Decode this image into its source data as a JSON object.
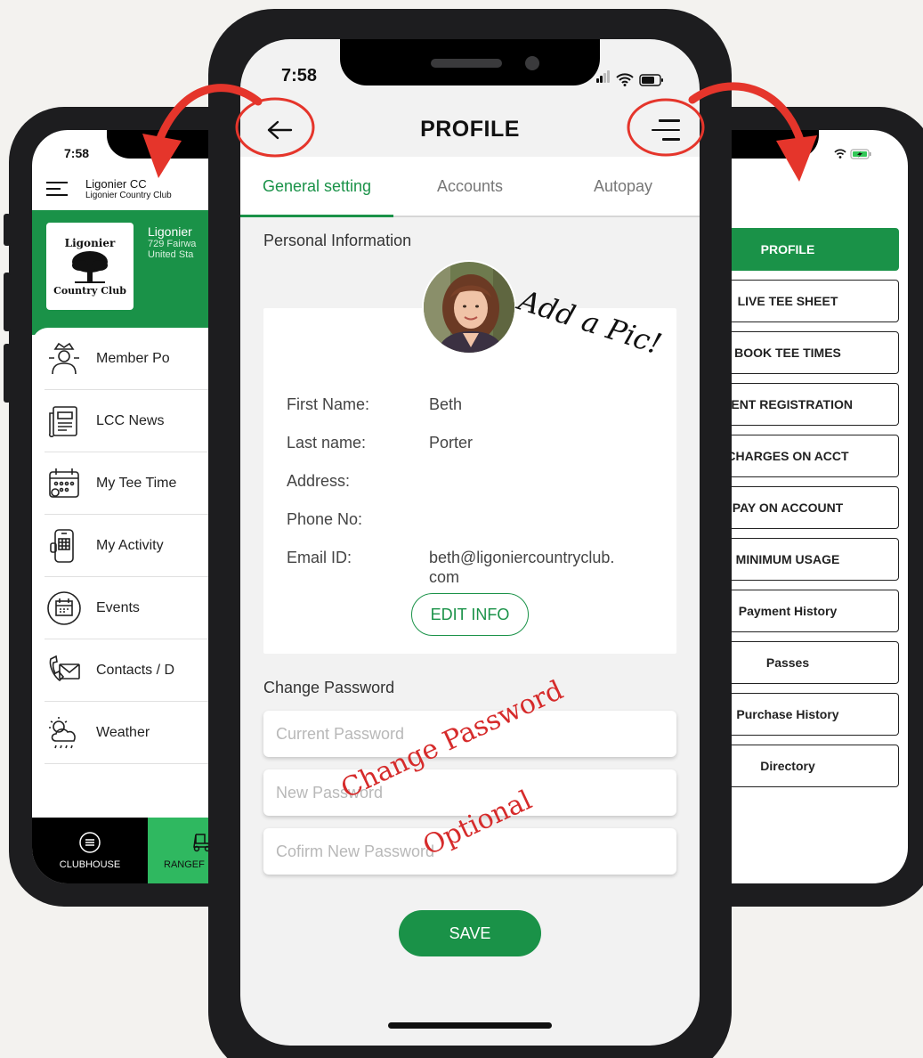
{
  "left_app": {
    "time": "7:58",
    "brand_title": "Ligonier CC",
    "brand_subtitle": "Ligonier Country Club",
    "logo_line1": "Ligonier",
    "logo_line2": "Country Club",
    "club_name": "Ligonier",
    "club_address1": "729 Fairwa",
    "club_address2": "United Sta",
    "menu": [
      {
        "label": "Member Po",
        "icon": "member-portal-icon"
      },
      {
        "label": "LCC News",
        "icon": "newspaper-icon"
      },
      {
        "label": "My Tee Time",
        "icon": "calendar-icon"
      },
      {
        "label": "My Activity",
        "icon": "phone-activity-icon"
      },
      {
        "label": "Events",
        "icon": "events-calendar-icon"
      },
      {
        "label": "Contacts / D",
        "icon": "contacts-icon"
      },
      {
        "label": "Weather",
        "icon": "weather-icon"
      }
    ],
    "tab_clubhouse": "CLUBHOUSE",
    "tab_ranger": "RANGEF"
  },
  "profile": {
    "time": "7:58",
    "title": "PROFILE",
    "tabs": [
      "General setting",
      "Accounts",
      "Autopay"
    ],
    "active_tab": 0,
    "personal_info_title": "Personal Information",
    "fields": [
      {
        "label": "First Name:",
        "value": "Beth"
      },
      {
        "label": "Last name:",
        "value": "Porter"
      },
      {
        "label": "Address:",
        "value": ""
      },
      {
        "label": "Phone No:",
        "value": ""
      },
      {
        "label": "Email ID:",
        "value": "beth@ligoniercountryclub.\ncom"
      }
    ],
    "edit_button": "EDIT INFO",
    "change_password_title": "Change Password",
    "current_password_placeholder": "Current Password",
    "new_password_placeholder": "New Password",
    "confirm_password_placeholder": "Cofirm New Password",
    "save_button": "SAVE"
  },
  "right_menu": {
    "items": [
      "PROFILE",
      "LIVE TEE SHEET",
      "BOOK TEE TIMES",
      "VENT REGISTRATION",
      "CHARGES ON ACCT",
      "PAY ON ACCOUNT",
      "MINIMUM USAGE",
      "Payment History",
      "Passes",
      "Purchase History",
      "Directory"
    ],
    "active_index": 0
  },
  "annotations": {
    "add_pic": "Add a Pic!",
    "change_password": "Change Password",
    "optional": "Optional"
  },
  "colors": {
    "brand_green": "#1a9248",
    "accent_red": "#e5352b",
    "phone_frame": "#1d1d1f"
  }
}
